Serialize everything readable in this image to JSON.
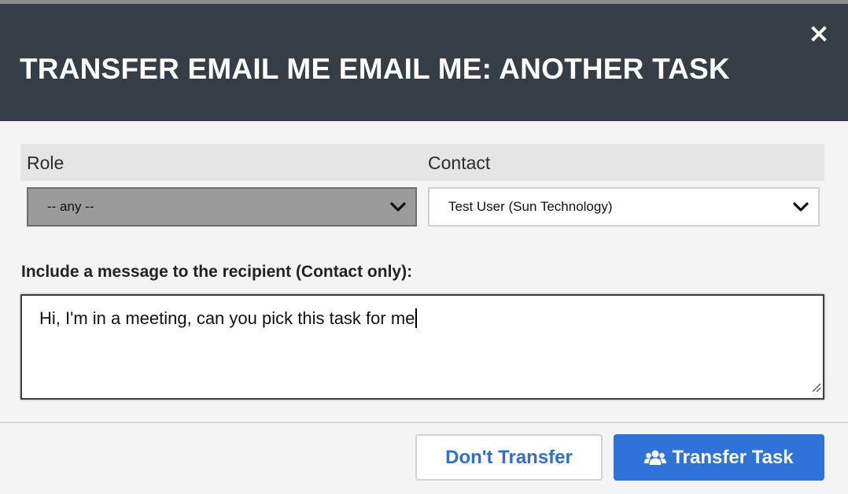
{
  "dialog": {
    "title": "TRANSFER EMAIL ME EMAIL ME: ANOTHER TASK",
    "close_icon": "close-icon"
  },
  "form": {
    "role_label": "Role",
    "contact_label": "Contact",
    "role_value": "-- any --",
    "contact_value": "Test User (Sun Technology)",
    "message_label": "Include a message to the recipient (Contact only):",
    "message_value": "Hi, I'm in a meeting, can you pick this task for me"
  },
  "footer": {
    "dont_transfer_label": "Don't Transfer",
    "transfer_label": "Transfer Task",
    "transfer_icon": "users-icon"
  },
  "colors": {
    "header_bg": "#353d47",
    "primary_button": "#2f73d9",
    "secondary_text": "#2f6fd0",
    "role_select_bg": "#9b9b9b"
  }
}
